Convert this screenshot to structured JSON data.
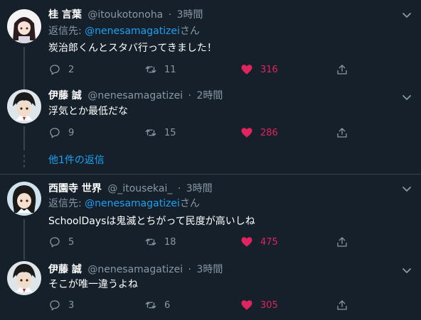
{
  "colors": {
    "background": "#15202b",
    "text_primary": "#ffffff",
    "text_secondary": "#8899a6",
    "link": "#1da1f2",
    "like": "#e0245e",
    "divider": "#38444d"
  },
  "tweets": [
    {
      "name": "桂 言葉",
      "handle": "@itoukotonoha",
      "sep": "·",
      "time": "3時間",
      "reply_prefix": "返信先: ",
      "reply_handle": "@nenesamagatizei",
      "reply_suffix": "さん",
      "text": "炭治郎くんとスタバ行ってきました！",
      "replies": "2",
      "retweets": "11",
      "likes": "316",
      "avatar_icon": "avatar-kotonoha"
    },
    {
      "name": "伊藤 誠",
      "handle": "@nenesamagatizei",
      "sep": "·",
      "time": "2時間",
      "text": "浮気とか最低だな",
      "replies": "9",
      "retweets": "15",
      "likes": "286",
      "avatar_icon": "avatar-makoto"
    },
    {
      "name": "西園寺 世界",
      "handle": "@_itousekai_",
      "sep": "·",
      "time": "3時間",
      "reply_prefix": "返信先: ",
      "reply_handle": "@nenesamagatizei",
      "reply_suffix": "さん",
      "text": "SchoolDaysは鬼滅とちがって民度が高いしね",
      "replies": "5",
      "retweets": "18",
      "likes": "475",
      "avatar_icon": "avatar-sekai"
    },
    {
      "name": "伊藤 誠",
      "handle": "@nenesamagatizei",
      "sep": "·",
      "time": "3時間",
      "text": "そこが唯一違うよね",
      "replies": "3",
      "retweets": "6",
      "likes": "305",
      "avatar_icon": "avatar-makoto"
    }
  ],
  "more_replies": {
    "label": "他1件の返信"
  },
  "icons": {
    "reply": "reply-icon",
    "retweet": "retweet-icon",
    "like": "heart-icon",
    "share": "share-icon",
    "menu": "chevron-down-icon"
  }
}
